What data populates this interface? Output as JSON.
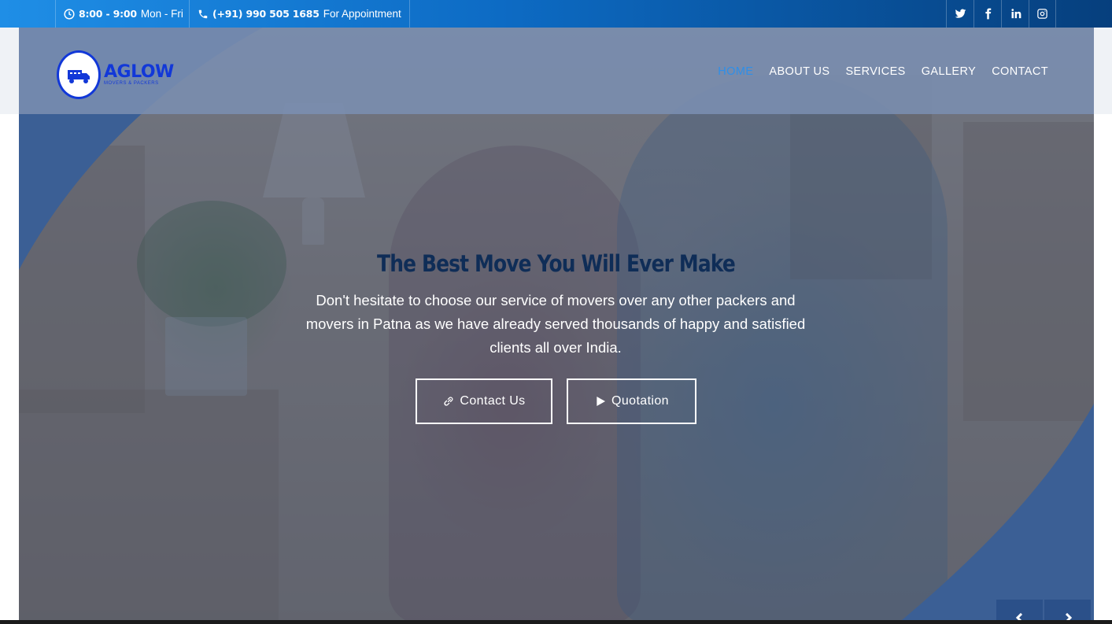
{
  "topbar": {
    "hours": {
      "time": "8:00 - 9:00",
      "days": "Mon - Fri",
      "icon": "clock-icon"
    },
    "phone": {
      "number": "(+91) 990 505 1685",
      "label": "For Appointment",
      "icon": "phone-icon"
    },
    "social": [
      "twitter-icon",
      "facebook-icon",
      "linkedin-icon",
      "instagram-icon"
    ]
  },
  "logo": {
    "name": "AGLOW",
    "subtitle": "MOVERS & PACKERS",
    "seal_text": "AGLOW MOVERS & PACKERS"
  },
  "nav": {
    "items": [
      {
        "label": "HOME",
        "active": true
      },
      {
        "label": "ABOUT US",
        "active": false
      },
      {
        "label": "SERVICES",
        "active": false
      },
      {
        "label": "GALLERY",
        "active": false
      },
      {
        "label": "CONTACT",
        "active": false
      }
    ]
  },
  "hero": {
    "title": "The Best Move You Will Ever Make",
    "text": "Don't hesitate to choose our service of movers over any other packers and movers in Patna as we have already served thousands of happy and satisfied clients all over India.",
    "buttons": {
      "contact": {
        "label": "Contact Us",
        "icon": "link-icon"
      },
      "quote": {
        "label": "Quotation",
        "icon": "play-icon"
      }
    }
  },
  "colors": {
    "topbar_start": "#1f8ee6",
    "topbar_end": "#063f7d",
    "accent_blue": "#2f8fe8",
    "title_navy": "#0f2d57",
    "logo_blue": "#1238d8",
    "swoosh": "#3b5f95"
  }
}
